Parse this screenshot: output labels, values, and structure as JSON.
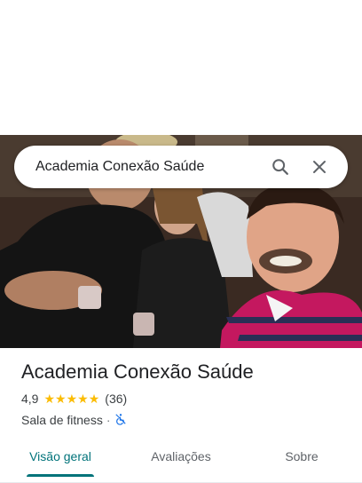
{
  "search": {
    "query": "Academia Conexão Saúde",
    "search_icon": "search-icon",
    "close_icon": "close-icon"
  },
  "photo": {
    "description_icon": "place-photo"
  },
  "place": {
    "name": "Academia Conexão Saúde",
    "rating": "4,9",
    "stars": 5,
    "review_count": "(36)",
    "category": "Sala de fitness",
    "separator": "·",
    "accessibility_icon": "not-wheelchair-accessible-icon"
  },
  "tabs": [
    {
      "label": "Visão geral",
      "active": true
    },
    {
      "label": "Avaliações",
      "active": false
    },
    {
      "label": "Sobre",
      "active": false
    }
  ],
  "colors": {
    "accent": "#01737a",
    "star": "#fbbc04",
    "accessibility": "#1a73e8"
  }
}
